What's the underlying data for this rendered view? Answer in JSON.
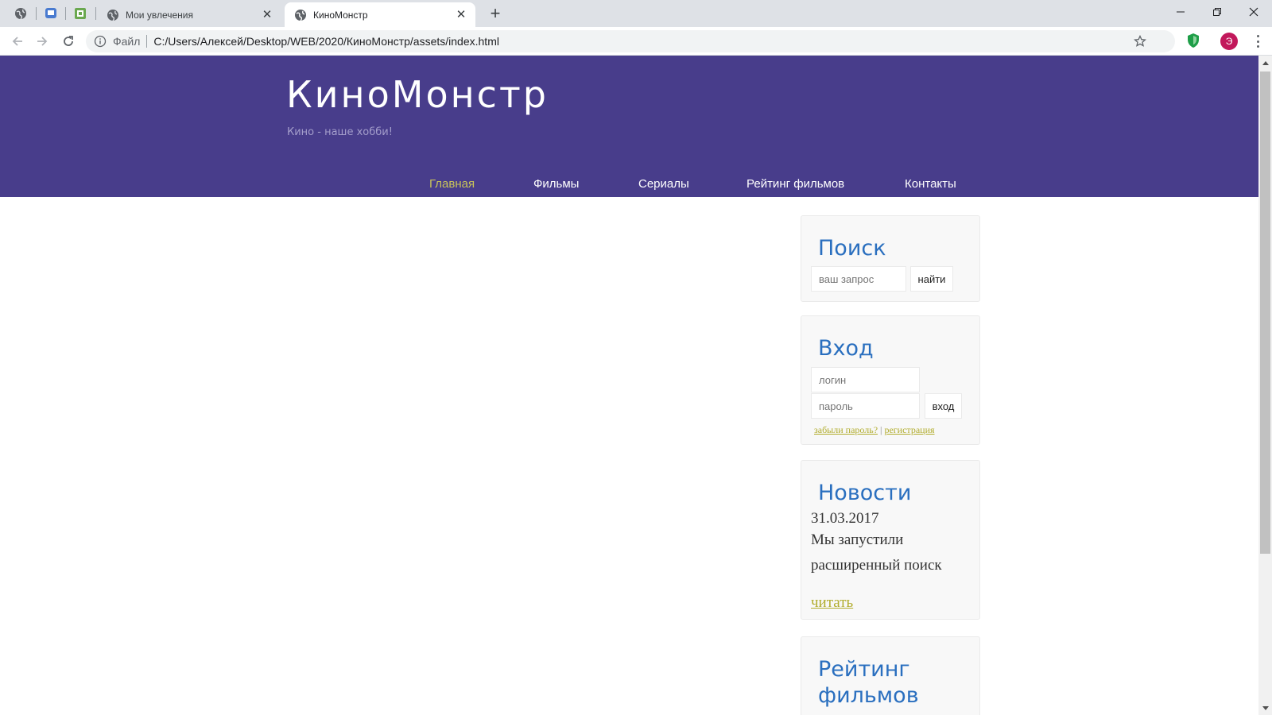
{
  "browser": {
    "tabs": [
      {
        "title": "Мои увлечения"
      },
      {
        "title": "КиноМонстр"
      }
    ],
    "new_tab": "+",
    "address": {
      "scheme_label": "Файл",
      "url": "C:/Users/Алексей/Desktop/WEB/2020/КиноМонстр/assets/index.html"
    },
    "profile_initial": "Э",
    "window_controls": {
      "minimize": "—",
      "restore": "❐",
      "close": "✕"
    }
  },
  "site": {
    "title": "КиноМонстр",
    "slogan": "Кино - наше хобби!",
    "nav": [
      {
        "label": "Главная",
        "active": true
      },
      {
        "label": "Фильмы"
      },
      {
        "label": "Сериалы"
      },
      {
        "label": "Рейтинг фильмов"
      },
      {
        "label": "Контакты"
      }
    ]
  },
  "sidebar": {
    "search": {
      "title": "Поиск",
      "placeholder": "ваш запрос",
      "button": "найти"
    },
    "login": {
      "title": "Вход",
      "login_placeholder": "логин",
      "password_placeholder": "пароль",
      "button": "вход",
      "forgot_link": "забыли пароль?",
      "separator": "|",
      "register_link": "регистрация"
    },
    "news": {
      "title": "Новости",
      "date": "31.03.2017",
      "text_line1": "Мы запустили",
      "text_line2": "расширенный поиск",
      "read_link": "читать"
    },
    "rating": {
      "title_line1": "Рейтинг",
      "title_line2": "фильмов"
    }
  },
  "colors": {
    "header_bg": "#483d8b",
    "nav_active": "#c9c45a",
    "widget_title": "#2a6fbf",
    "link": "#b1ac2c"
  }
}
